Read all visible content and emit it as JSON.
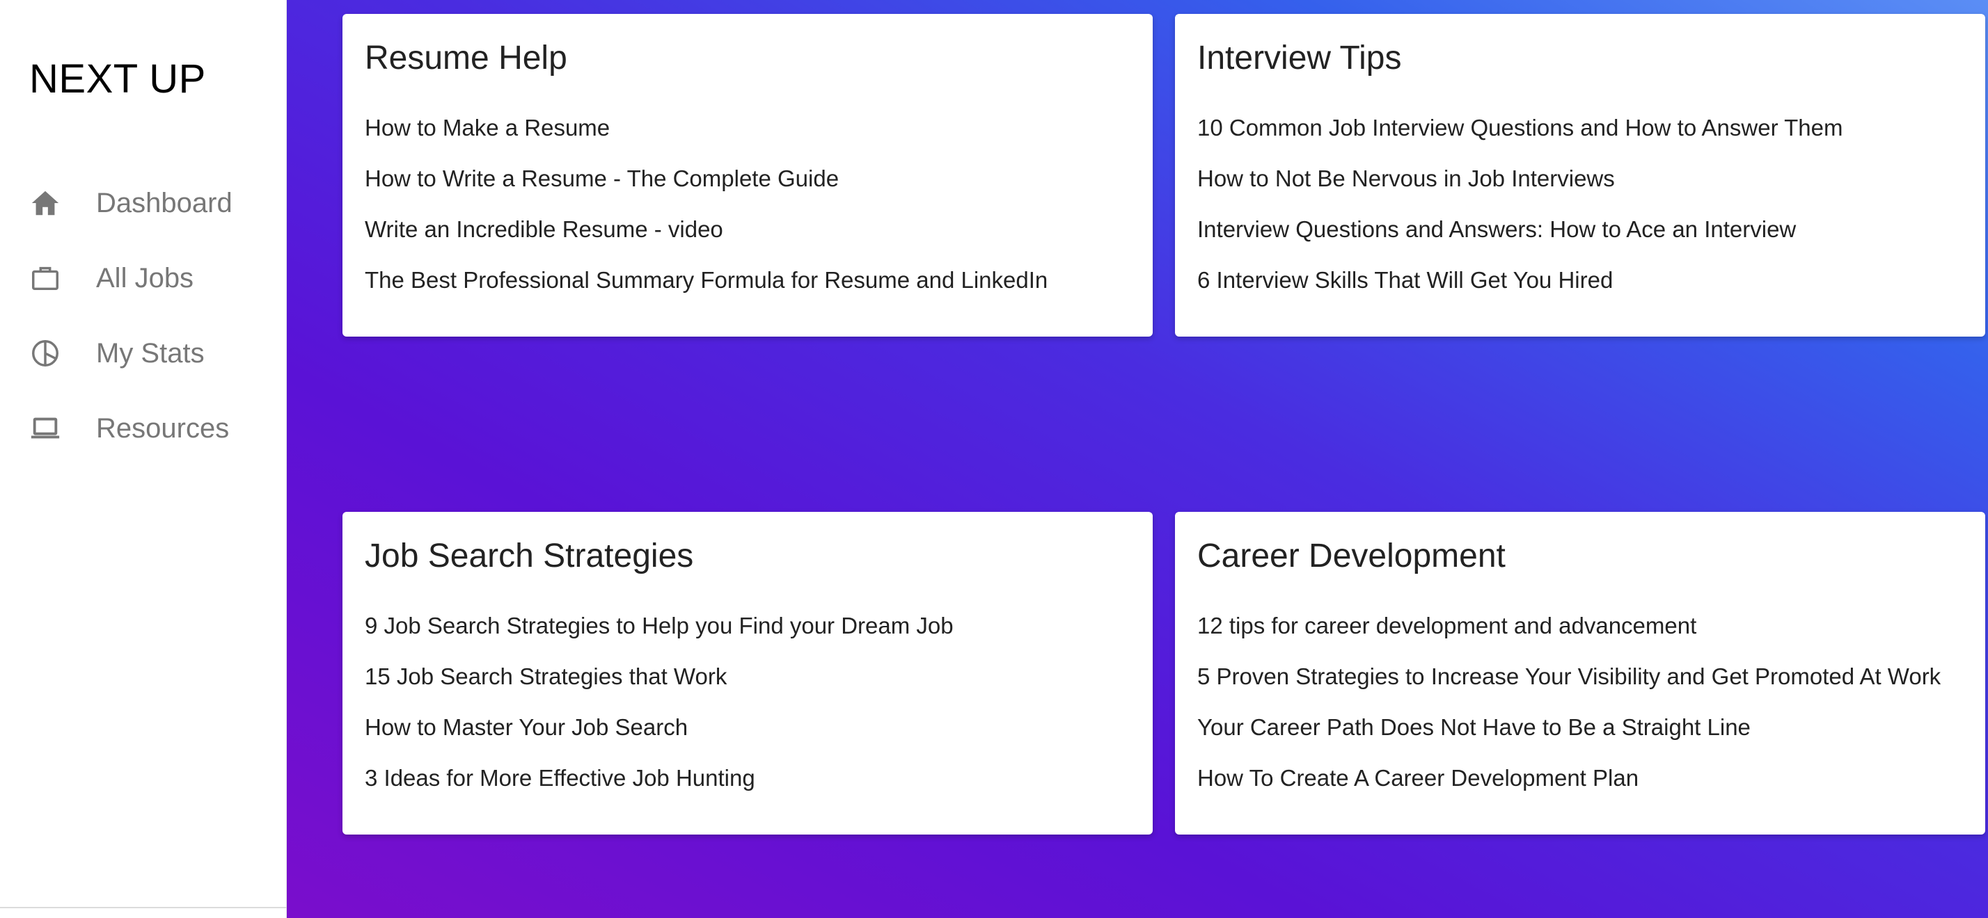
{
  "app": {
    "brand": "NEXT UP"
  },
  "sidebar": {
    "items": [
      {
        "label": "Dashboard",
        "icon": "home-icon"
      },
      {
        "label": "All Jobs",
        "icon": "briefcase-icon"
      },
      {
        "label": "My Stats",
        "icon": "pie-chart-icon"
      },
      {
        "label": "Resources",
        "icon": "laptop-icon"
      }
    ]
  },
  "colors": {
    "sidebar_bg": "#ffffff",
    "nav_icon": "#777777",
    "nav_text": "#777777",
    "gradient_start": "#7a0ecc",
    "gradient_end": "#5b8ef5",
    "card_bg": "#ffffff"
  },
  "cards": [
    {
      "title": "Resume Help",
      "links": [
        "How to Make a Resume",
        "How to Write a Resume - The Complete Guide",
        "Write an Incredible Resume - video",
        "The Best Professional Summary Formula for Resume and LinkedIn"
      ]
    },
    {
      "title": "Interview Tips",
      "links": [
        "10 Common Job Interview Questions and How to Answer Them",
        "How to Not Be Nervous in Job Interviews",
        "Interview Questions and Answers: How to Ace an Interview",
        "6 Interview Skills That Will Get You Hired"
      ]
    },
    {
      "title": "Job Search Strategies",
      "links": [
        "9 Job Search Strategies to Help you Find your Dream Job",
        "15 Job Search Strategies that Work",
        "How to Master Your Job Search",
        "3 Ideas for More Effective Job Hunting"
      ]
    },
    {
      "title": "Career Development",
      "links": [
        "12 tips for career development and advancement",
        "5 Proven Strategies to Increase Your Visibility and Get Promoted At Work",
        "Your Career Path Does Not Have to Be a Straight Line",
        "How To Create A Career Development Plan"
      ]
    }
  ]
}
